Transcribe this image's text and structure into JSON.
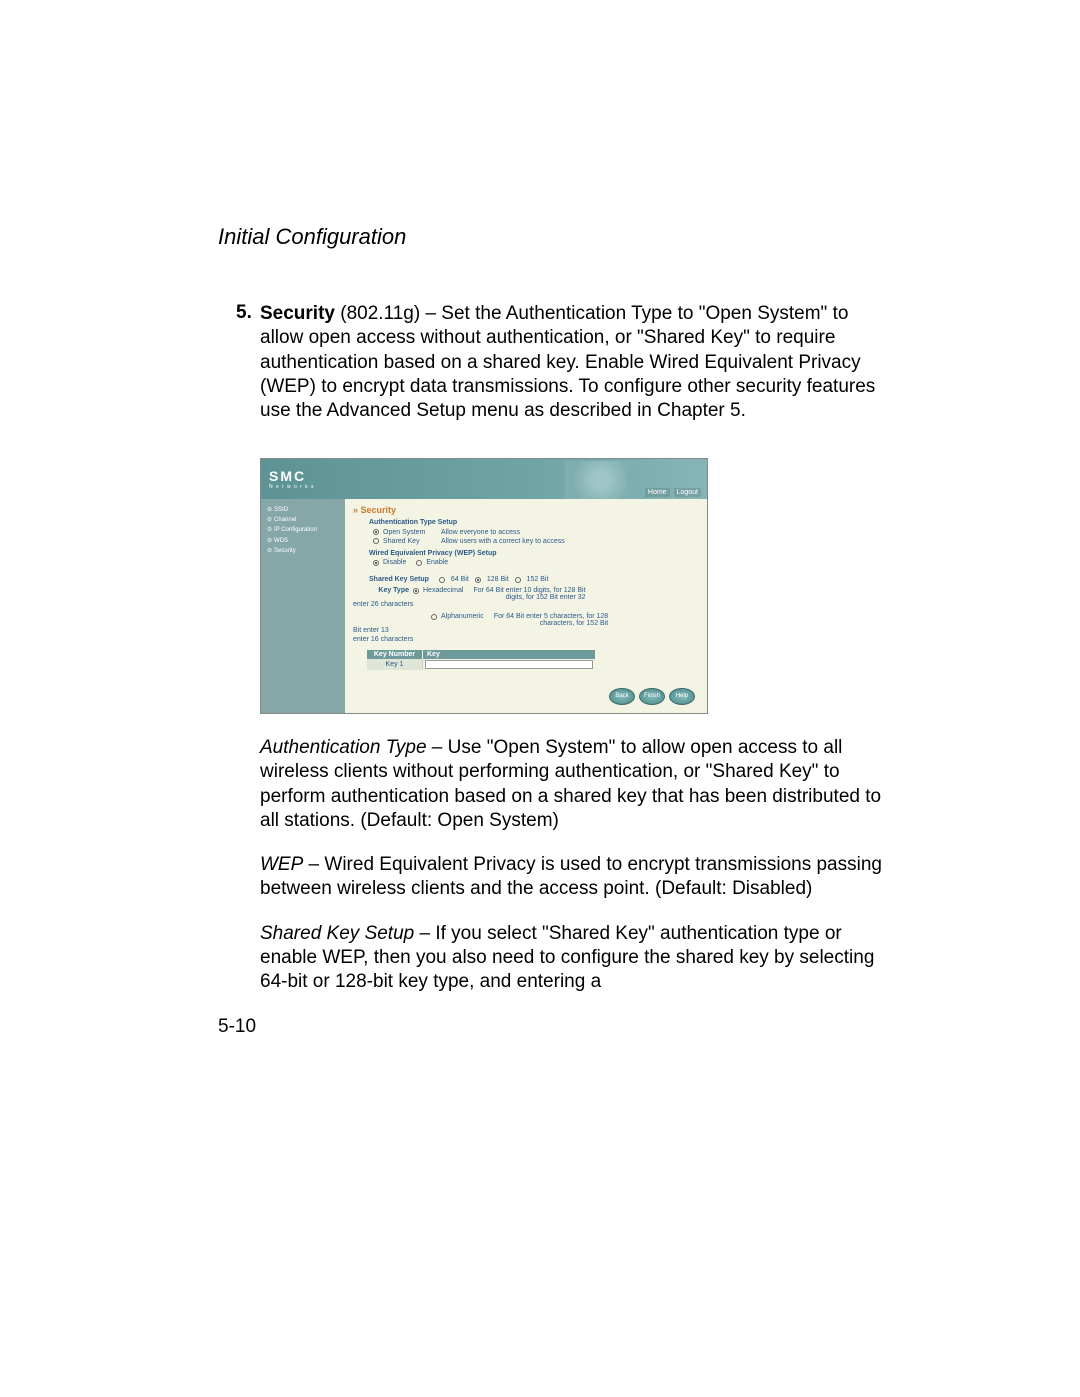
{
  "header": {
    "title": "Initial Configuration"
  },
  "list": {
    "num": "5.",
    "bold": "Security",
    "text": " (802.11g) – Set the Authentication Type to \"Open System\" to allow open access without authentication, or \"Shared Key\" to require authentication based on a shared key. Enable Wired Equivalent Privacy (WEP) to encrypt data transmissions. To configure other security features use the Advanced Setup menu as described in Chapter 5."
  },
  "screenshot": {
    "logo": "SMC",
    "logo_sub": "N e t w o r k s",
    "links": {
      "home": "Home",
      "logout": "Logout"
    },
    "sidebar": [
      "SSID",
      "Channel",
      "IP Configuration",
      "WDS",
      "Security"
    ],
    "title": "Security",
    "auth_setup": "Authentication Type Setup",
    "open_system": {
      "label": "Open System",
      "desc": "Allow everyone to access"
    },
    "shared_key": {
      "label": "Shared Key",
      "desc": "Allow users with a correct key to access"
    },
    "wep_setup": "Wired Equivalent Privacy (WEP) Setup",
    "disable": "Disable",
    "enable": "Enable",
    "sks": "Shared Key Setup",
    "bit64": "64 Bit",
    "bit128": "128 Bit",
    "bit152": "152 Bit",
    "key_type": "Key Type",
    "hex": "Hexadecimal",
    "hex_desc1": "For 64 Bit enter 10 digits, for 128 Bit",
    "hex_desc2": "digits, for 152 Bit enter 32",
    "enter26": "enter 26 characters",
    "alpha": "Alphanumeric",
    "alpha_desc1": "For 64 Bit enter 5 characters, for 128",
    "alpha_desc2": "characters, for 152 Bit",
    "bit_enter13": "Bit enter 13",
    "enter16": "enter 16 characters",
    "key_number": "Key Number",
    "key": "Key",
    "key1": "Key 1",
    "back": "Back",
    "finish": "Finish",
    "help": "Help"
  },
  "para1": {
    "ital": "Authentication Type",
    "text": " – Use \"Open System\" to allow open access to all wireless clients without performing authentication, or \"Shared Key\" to perform authentication based on a shared key that has been distributed to all stations. (Default: Open System)"
  },
  "para2": {
    "ital": "WEP",
    "text": " – Wired Equivalent Privacy is used to encrypt transmissions passing between wireless clients and the access point. (Default: Disabled)"
  },
  "para3": {
    "ital": "Shared Key Setup",
    "text": " – If you select \"Shared Key\" authentication type or enable WEP, then you also need to configure the shared key by selecting 64-bit or 128-bit key type, and entering a"
  },
  "page_num": "5-10"
}
